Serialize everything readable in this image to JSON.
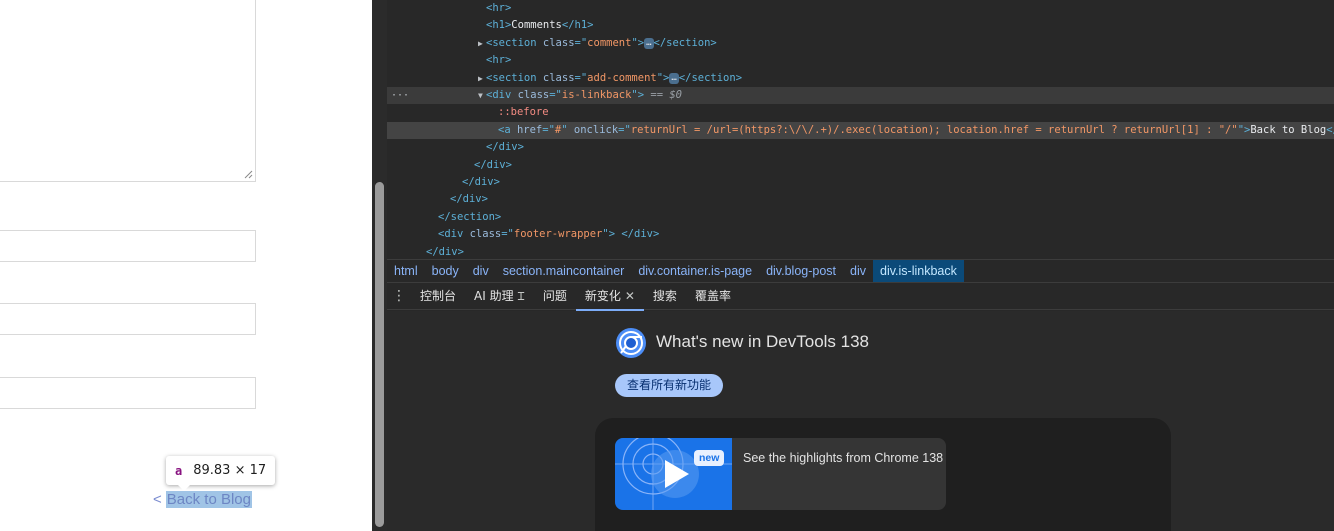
{
  "page": {
    "tooltip": {
      "tag": "a",
      "size": "89.83 × 17"
    },
    "back_link": {
      "prefix": "<",
      "label": "Back to Blog"
    }
  },
  "elements_panel": {
    "lines": [
      {
        "indent": 8,
        "parts": [
          [
            "tg",
            "<hr>"
          ]
        ]
      },
      {
        "indent": 8,
        "parts": [
          [
            "tg",
            "<h1>"
          ],
          [
            "tx",
            "Comments"
          ],
          [
            "tg",
            "</h1>"
          ]
        ]
      },
      {
        "indent": 8,
        "tri": "▶",
        "parts": [
          [
            "tg",
            "<section "
          ],
          [
            "an",
            "class"
          ],
          [
            "tg",
            "=\""
          ],
          [
            "av",
            "comment"
          ],
          [
            "tg",
            "\">"
          ],
          [
            "ell",
            "…"
          ],
          [
            "tg",
            "</section>"
          ]
        ]
      },
      {
        "indent": 8,
        "parts": [
          [
            "tg",
            "<hr>"
          ]
        ]
      },
      {
        "indent": 8,
        "tri": "▶",
        "parts": [
          [
            "tg",
            "<section "
          ],
          [
            "an",
            "class"
          ],
          [
            "tg",
            "=\""
          ],
          [
            "av",
            "add-comment"
          ],
          [
            "tg",
            "\">"
          ],
          [
            "ell",
            "…"
          ],
          [
            "tg",
            "</section>"
          ]
        ]
      },
      {
        "indent": 8,
        "tri": "▼",
        "dots": "···",
        "parts": [
          [
            "tg",
            "<div "
          ],
          [
            "an",
            "class"
          ],
          [
            "tg",
            "=\""
          ],
          [
            "av",
            "is-linkback"
          ],
          [
            "tg",
            "\">"
          ],
          [
            "eq",
            " == $0"
          ]
        ]
      },
      {
        "indent": 9,
        "parts": [
          [
            "ps",
            "::before"
          ]
        ]
      },
      {
        "indent": 9,
        "hover": true,
        "parts": [
          [
            "tg",
            "<a "
          ],
          [
            "an",
            "href"
          ],
          [
            "tg",
            "=\""
          ],
          [
            "av",
            "#"
          ],
          [
            "tg",
            "\" "
          ],
          [
            "an",
            "onclick"
          ],
          [
            "tg",
            "=\""
          ],
          [
            "av",
            "returnUrl = /url=(https?:\\/\\/.+)/.exec(location); location.href = returnUrl ? returnUrl[1] : \"/\""
          ],
          [
            "tg",
            "\">"
          ],
          [
            "tx",
            "Back to Blog"
          ],
          [
            "tg",
            "</a>"
          ]
        ]
      },
      {
        "indent": 8,
        "parts": [
          [
            "tg",
            "</div>"
          ]
        ]
      },
      {
        "indent": 7,
        "parts": [
          [
            "tg",
            "</div>"
          ]
        ]
      },
      {
        "indent": 6,
        "parts": [
          [
            "tg",
            "</div>"
          ]
        ]
      },
      {
        "indent": 5,
        "parts": [
          [
            "tg",
            "</div>"
          ]
        ]
      },
      {
        "indent": 4,
        "parts": [
          [
            "tg",
            "</section>"
          ]
        ]
      },
      {
        "indent": 4,
        "parts": [
          [
            "tg",
            "<div "
          ],
          [
            "an",
            "class"
          ],
          [
            "tg",
            "=\""
          ],
          [
            "av",
            "footer-wrapper"
          ],
          [
            "tg",
            "\"> </div>"
          ]
        ]
      },
      {
        "indent": 3,
        "parts": [
          [
            "tg",
            "</div>"
          ]
        ]
      }
    ]
  },
  "breadcrumbs": [
    "html",
    "body",
    "div",
    "section.maincontainer",
    "div.container.is-page",
    "div.blog-post",
    "div",
    "div.is-linkback"
  ],
  "drawer": {
    "menu_icon": "kebab-menu-icon",
    "tabs": [
      {
        "label": "控制台"
      },
      {
        "label": "AI 助理",
        "icon": "flask-icon"
      },
      {
        "label": "问题"
      },
      {
        "label": "新变化",
        "active": true,
        "closable": true
      },
      {
        "label": "搜索"
      },
      {
        "label": "覆盖率"
      }
    ]
  },
  "whats_new": {
    "logo_icon": "chrome-logo-icon",
    "title": "What's new in DevTools 138",
    "button": "查看所有新功能",
    "video": {
      "badge": "new",
      "text": "See the highlights from Chrome 138",
      "icon": "play-icon"
    }
  },
  "colors": {
    "devtools_bg": "#282828",
    "tag": "#5db0d7",
    "attr_value": "#f29766",
    "crumb_active": "#0b4a79",
    "button": "#a8c7fa"
  }
}
